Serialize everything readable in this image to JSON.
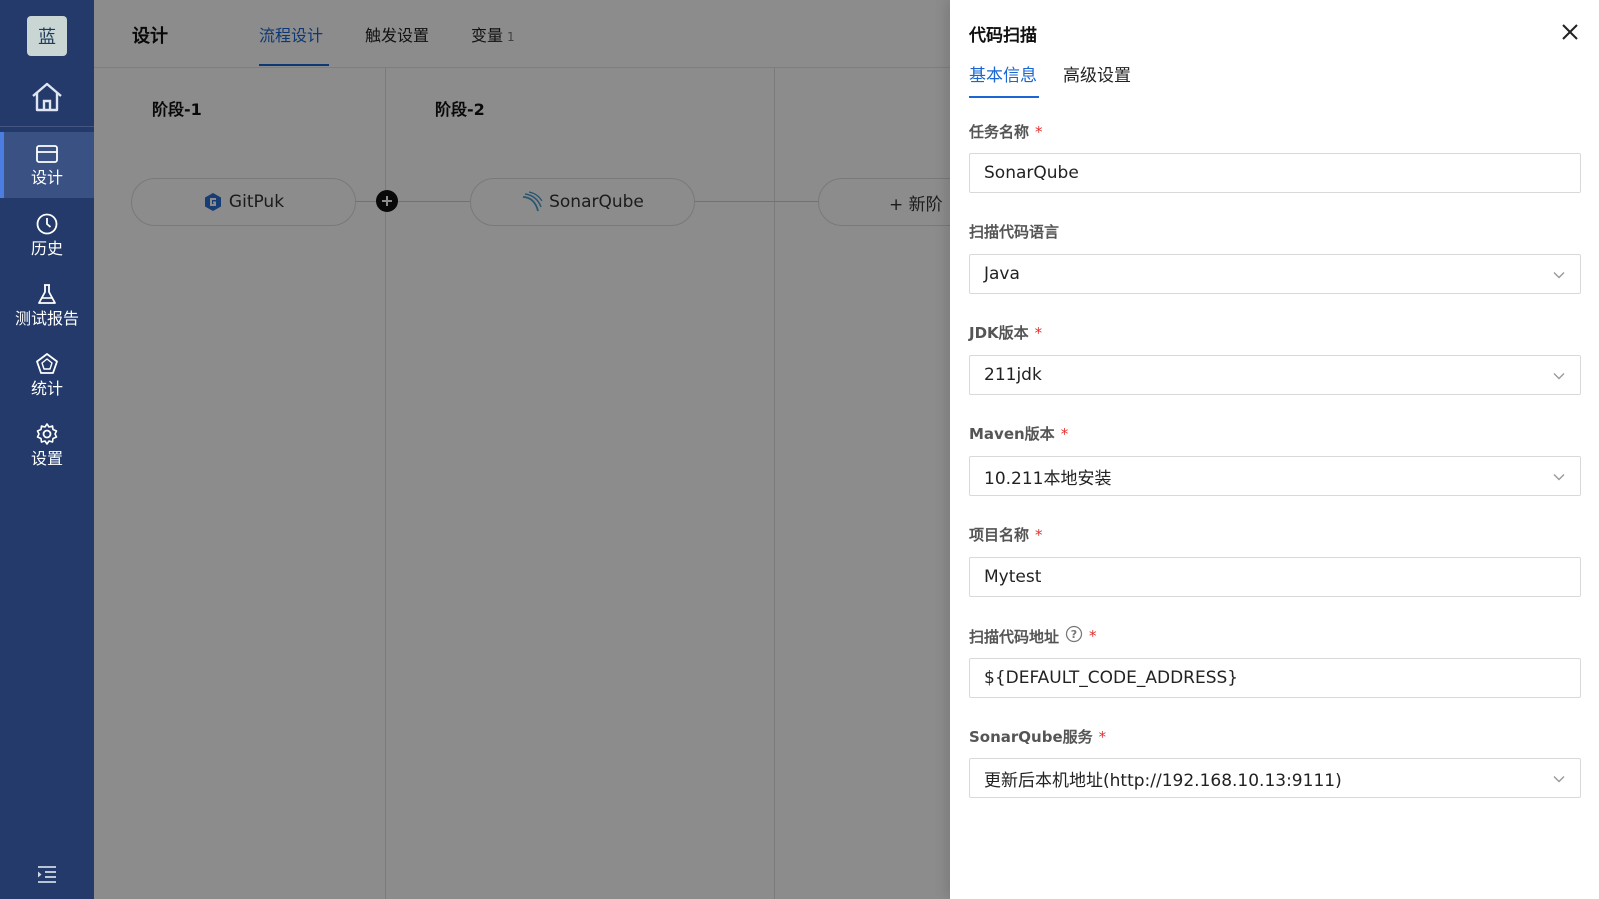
{
  "sidebar": {
    "logo": "蓝",
    "items": [
      {
        "label": "设计",
        "icon": "design-icon"
      },
      {
        "label": "历史",
        "icon": "clock-icon"
      },
      {
        "label": "测试报告",
        "icon": "flask-icon"
      },
      {
        "label": "统计",
        "icon": "pentagon-icon"
      },
      {
        "label": "设置",
        "icon": "gear-icon"
      }
    ]
  },
  "main": {
    "title": "设计",
    "tabs": [
      {
        "label": "流程设计"
      },
      {
        "label": "触发设置"
      },
      {
        "label": "变量",
        "count": "1"
      }
    ],
    "stages": [
      {
        "title": "阶段-1",
        "task": "GitPuk"
      },
      {
        "title": "阶段-2",
        "task": "SonarQube"
      }
    ],
    "new_stage_label": "+ 新阶"
  },
  "drawer": {
    "title": "代码扫描",
    "tabs": [
      {
        "label": "基本信息"
      },
      {
        "label": "高级设置"
      }
    ],
    "fields": [
      {
        "label": "任务名称",
        "value": "SonarQube"
      },
      {
        "label": "扫描代码语言",
        "value": "Java"
      },
      {
        "label": "JDK版本",
        "value": "211jdk"
      },
      {
        "label": "Maven版本",
        "value": "10.211本地安装"
      },
      {
        "label": "项目名称",
        "value": "Mytest"
      },
      {
        "label": "扫描代码地址",
        "value": "${DEFAULT_CODE_ADDRESS}"
      },
      {
        "label": "SonarQube服务",
        "value": "更新后本机地址(http://192.168.10.13:9111)"
      }
    ],
    "required_mark": "*",
    "help_mark": "?"
  },
  "colors": {
    "sidebar_bg": "#233a6a",
    "accent": "#1a66d2",
    "required": "#e0302f"
  }
}
